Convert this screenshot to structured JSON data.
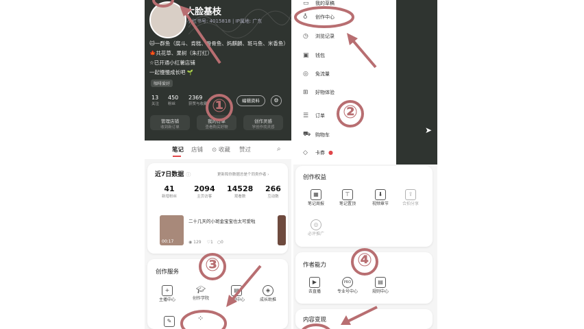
{
  "profile": {
    "name": "大脸基枝",
    "id_line": "小红书号: 4015818 | IP属地: 广东",
    "bio_lines": [
      "🐱一群鱼（腐斗、肯糕、骨骨鱼、妈麒麟、斑马鱼、米香鱼）",
      "🍁共花草、果树（朱打红）",
      "☆已开通小红薯店铺",
      "一起慢慢成长吧 🌱"
    ],
    "tag": "咖啡爱好",
    "stats": [
      {
        "num": "13",
        "label": "关注"
      },
      {
        "num": "450",
        "label": "粉丝"
      },
      {
        "num": "2369",
        "label": "获赞与收藏"
      }
    ],
    "edit_label": "编辑资料",
    "actions": [
      {
        "label": "管理店铺",
        "sub": "收到新订单"
      },
      {
        "label": "我的订单",
        "sub": "查看购买好物"
      },
      {
        "label": "创作灵感",
        "sub": "学创作找灵感"
      }
    ]
  },
  "tabs": [
    "笔记",
    "店铺",
    "收藏",
    "赞过"
  ],
  "menu": {
    "items": [
      {
        "icon": "wallet-icon",
        "label": "我的草稿"
      },
      {
        "icon": "bulb-icon",
        "label": "创作中心"
      },
      {
        "icon": "clock-icon",
        "label": "浏览记录"
      },
      {
        "icon": "wallet-icon",
        "label": "钱包"
      },
      {
        "icon": "flow-icon",
        "label": "免流量"
      },
      {
        "icon": "gift-icon",
        "label": "好物体验"
      },
      {
        "icon": "order-icon",
        "label": "订单"
      },
      {
        "icon": "cart-icon",
        "label": "购物车"
      },
      {
        "icon": "coupon-icon",
        "label": "卡券"
      }
    ]
  },
  "data7": {
    "title": "近7日数据",
    "link": "更新和你数据总是个同类作者 ›",
    "metrics": [
      {
        "num": "41",
        "label": "新增粉丝"
      },
      {
        "num": "2094",
        "label": "主页访客"
      },
      {
        "num": "14528",
        "label": "观看数"
      },
      {
        "num": "266",
        "label": "互动数"
      }
    ],
    "note": {
      "title": "二十几天的小斑金宝宝也太可爱啦",
      "time": "00:17",
      "views": "129",
      "likes": "1",
      "comments": "0"
    }
  },
  "services": {
    "title": "创作服务",
    "items": [
      "主播中心",
      "创作学院",
      "规则中心",
      "成长助推"
    ]
  },
  "rights": {
    "title": "创作权益",
    "items": [
      "笔记周报",
      "笔记置顶",
      "视频章节",
      "合拍分享",
      "必评推广"
    ]
  },
  "ability": {
    "title": "作者能力",
    "items": [
      "去直播",
      "专业号中心",
      "规则中心"
    ]
  },
  "monetize": {
    "title": "内容变现"
  },
  "annotations": {
    "n1": "①",
    "n2": "②",
    "n3": "③",
    "n4": "④"
  },
  "colors": {
    "annotation": "#b86e71",
    "dark": "#2f3430",
    "accent": "#e0464a"
  }
}
